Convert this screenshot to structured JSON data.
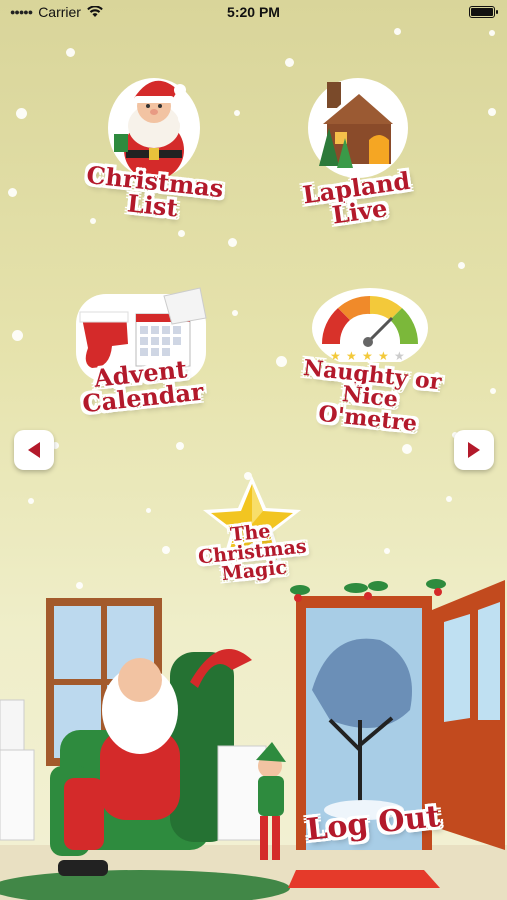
{
  "status_bar": {
    "carrier": "Carrier",
    "time": "5:20 PM",
    "battery_level": 1.0
  },
  "menu": {
    "christmas_list": "Christmas\nList",
    "lapland_live": "Lapland\nLive",
    "advent_calendar": "Advent\nCalendar",
    "naughty_nice": "Naughty or\nNice O'metre",
    "christmas_magic": "The\nChristmas\nMagic",
    "log_out": "Log Out"
  },
  "nav": {
    "left_icon": "chevron-left-icon",
    "right_icon": "chevron-right-icon"
  },
  "colors": {
    "accent_red": "#b3192b",
    "background_top": "#d9d59a",
    "background_bottom": "#f3f1d4"
  }
}
